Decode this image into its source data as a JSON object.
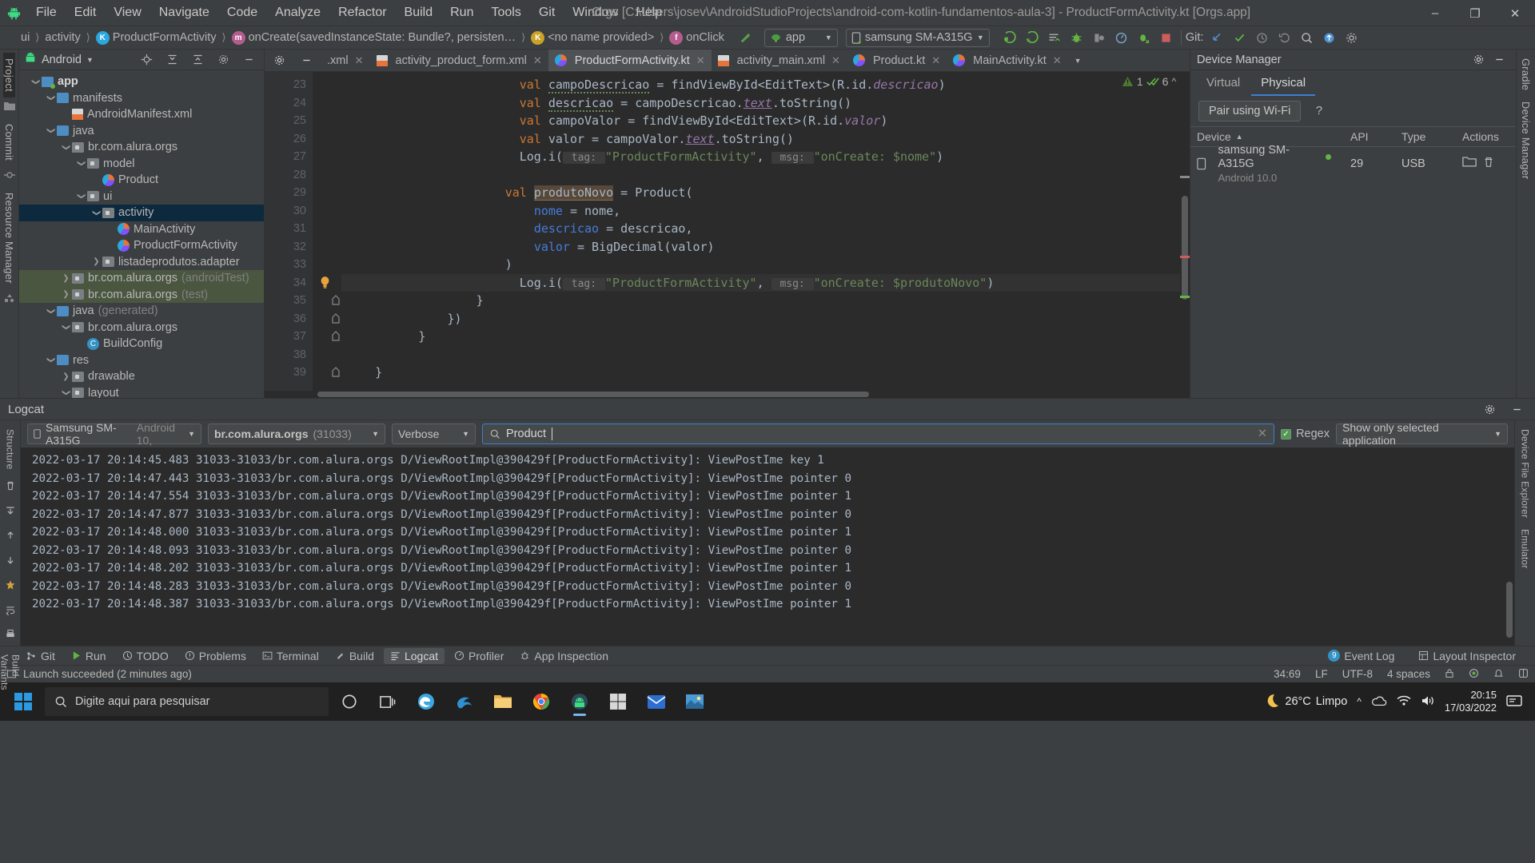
{
  "window": {
    "title": "Orgs [C:\\Users\\josev\\AndroidStudioProjects\\android-com-kotlin-fundamentos-aula-3] - ProductFormActivity.kt [Orgs.app]",
    "minimize": "–",
    "maximize": "❐",
    "close": "✕"
  },
  "menu": [
    "File",
    "Edit",
    "View",
    "Navigate",
    "Code",
    "Analyze",
    "Refactor",
    "Build",
    "Run",
    "Tools",
    "Git",
    "Window",
    "Help"
  ],
  "breadcrumbs": [
    {
      "label": "ui",
      "icon": ""
    },
    {
      "label": "activity",
      "icon": ""
    },
    {
      "label": "ProductFormActivity",
      "icon": "kotlin-class-icon"
    },
    {
      "label": "onCreate(savedInstanceState: Bundle?, persisten…",
      "icon": "method-icon"
    },
    {
      "label": "<no name provided>",
      "icon": "kotlin-object-icon"
    },
    {
      "label": "onClick",
      "icon": "function-icon"
    }
  ],
  "toolbar": {
    "module_selector": "app",
    "device_selector": "samsung SM-A315G",
    "git_label": "Git:",
    "icons": [
      "run-icon",
      "run-with-coverage-icon",
      "apply-changes-icon",
      "debug-icon",
      "profile-icon",
      "app-inspection-icon",
      "attach-debugger-icon",
      "stop-icon",
      "git-update-icon",
      "git-commit-icon",
      "git-history-icon",
      "search-icon",
      "upload-icon",
      "settings-icon"
    ]
  },
  "left_rail": [
    "Project",
    "Commit",
    "Resource Manager"
  ],
  "left_rail_bottom": [
    "Structure",
    "Favorites",
    "Build Variants"
  ],
  "right_rail": [
    "Gradle",
    "Device Manager",
    "Device File Explorer",
    "Emulator"
  ],
  "project_panel": {
    "title": "Android",
    "header_icons": [
      "locate-icon",
      "expand-all-icon",
      "collapse-all-icon",
      "settings-icon",
      "hide-icon"
    ],
    "tree": [
      {
        "depth": 0,
        "arrow": "down",
        "icon": "folder-module",
        "label": "app",
        "suffix": "",
        "bold": true,
        "state": "normal"
      },
      {
        "depth": 1,
        "arrow": "down",
        "icon": "folder-blue",
        "label": "manifests",
        "suffix": "",
        "bold": false,
        "state": "normal"
      },
      {
        "depth": 2,
        "arrow": "none",
        "icon": "xml-file",
        "label": "AndroidManifest.xml",
        "suffix": "",
        "bold": false,
        "state": "normal"
      },
      {
        "depth": 1,
        "arrow": "down",
        "icon": "folder-blue",
        "label": "java",
        "suffix": "",
        "bold": false,
        "state": "normal"
      },
      {
        "depth": 2,
        "arrow": "down",
        "icon": "folder-package",
        "label": "br.com.alura.orgs",
        "suffix": "",
        "bold": false,
        "state": "normal"
      },
      {
        "depth": 3,
        "arrow": "down",
        "icon": "folder-package",
        "label": "model",
        "suffix": "",
        "bold": false,
        "state": "normal"
      },
      {
        "depth": 4,
        "arrow": "none",
        "icon": "kotlin-file",
        "label": "Product",
        "suffix": "",
        "bold": false,
        "state": "normal"
      },
      {
        "depth": 3,
        "arrow": "down",
        "icon": "folder-package",
        "label": "ui",
        "suffix": "",
        "bold": false,
        "state": "normal"
      },
      {
        "depth": 4,
        "arrow": "down",
        "icon": "folder-package",
        "label": "activity",
        "suffix": "",
        "bold": false,
        "state": "selected"
      },
      {
        "depth": 5,
        "arrow": "none",
        "icon": "kotlin-file",
        "label": "MainActivity",
        "suffix": "",
        "bold": false,
        "state": "normal"
      },
      {
        "depth": 5,
        "arrow": "none",
        "icon": "kotlin-file",
        "label": "ProductFormActivity",
        "suffix": "",
        "bold": false,
        "state": "normal"
      },
      {
        "depth": 4,
        "arrow": "right",
        "icon": "folder-package",
        "label": "listadeprodutos.adapter",
        "suffix": "",
        "bold": false,
        "state": "normal"
      },
      {
        "depth": 2,
        "arrow": "right",
        "icon": "folder-package",
        "label": "br.com.alura.orgs",
        "suffix": "(androidTest)",
        "bold": false,
        "state": "testsrc"
      },
      {
        "depth": 2,
        "arrow": "right",
        "icon": "folder-package",
        "label": "br.com.alura.orgs",
        "suffix": "(test)",
        "bold": false,
        "state": "testsrc"
      },
      {
        "depth": 1,
        "arrow": "down",
        "icon": "folder-generated",
        "label": "java",
        "suffix": "(generated)",
        "bold": false,
        "state": "normal"
      },
      {
        "depth": 2,
        "arrow": "down",
        "icon": "folder-package",
        "label": "br.com.alura.orgs",
        "suffix": "",
        "bold": false,
        "state": "normal"
      },
      {
        "depth": 3,
        "arrow": "none",
        "icon": "class-file",
        "label": "BuildConfig",
        "suffix": "",
        "bold": false,
        "state": "normal"
      },
      {
        "depth": 1,
        "arrow": "down",
        "icon": "folder-res",
        "label": "res",
        "suffix": "",
        "bold": false,
        "state": "normal"
      },
      {
        "depth": 2,
        "arrow": "right",
        "icon": "folder-package",
        "label": "drawable",
        "suffix": "",
        "bold": false,
        "state": "normal"
      },
      {
        "depth": 2,
        "arrow": "down",
        "icon": "folder-package",
        "label": "layout",
        "suffix": "",
        "bold": false,
        "state": "normal"
      }
    ]
  },
  "editor": {
    "tabs": [
      {
        "label": ".xml",
        "icon": "xml-file",
        "active": false
      },
      {
        "label": "activity_product_form.xml",
        "icon": "xml-file",
        "active": false
      },
      {
        "label": "ProductFormActivity.kt",
        "icon": "kotlin-file",
        "active": true
      },
      {
        "label": "activity_main.xml",
        "icon": "xml-file",
        "active": false
      },
      {
        "label": "Product.kt",
        "icon": "kotlin-file",
        "active": false
      },
      {
        "label": "MainActivity.kt",
        "icon": "kotlin-file",
        "active": false
      }
    ],
    "inspection": {
      "warnings": "1",
      "checks": "6"
    },
    "first_line_number": 23,
    "lines": [
      {
        "n": 23,
        "indent": 12,
        "segments": [
          {
            "t": "val ",
            "c": "kw"
          },
          {
            "t": "campoDescricao",
            "c": "warnsq"
          },
          {
            "t": " = findViewById<EditText>(R.id.",
            "c": "plain"
          },
          {
            "t": "descricao",
            "c": "pv"
          },
          {
            "t": ")",
            "c": "plain"
          }
        ]
      },
      {
        "n": 24,
        "indent": 12,
        "segments": [
          {
            "t": "val ",
            "c": "kw"
          },
          {
            "t": "descricao",
            "c": "warnsq"
          },
          {
            "t": " = campoDescricao.",
            "c": "plain"
          },
          {
            "t": "text",
            "c": "pv-u"
          },
          {
            "t": ".toString()",
            "c": "plain"
          }
        ]
      },
      {
        "n": 25,
        "indent": 12,
        "segments": [
          {
            "t": "val ",
            "c": "kw"
          },
          {
            "t": "campoValor",
            "c": "plain"
          },
          {
            "t": " = findViewById<EditText>(R.id.",
            "c": "plain"
          },
          {
            "t": "valor",
            "c": "pv"
          },
          {
            "t": ")",
            "c": "plain"
          }
        ]
      },
      {
        "n": 26,
        "indent": 12,
        "segments": [
          {
            "t": "val ",
            "c": "kw"
          },
          {
            "t": "valor",
            "c": "plain"
          },
          {
            "t": " = campoValor.",
            "c": "plain"
          },
          {
            "t": "text",
            "c": "pv-u"
          },
          {
            "t": ".toString()",
            "c": "plain"
          }
        ]
      },
      {
        "n": 27,
        "indent": 12,
        "segments": [
          {
            "t": "Log.i(",
            "c": "plain"
          },
          {
            "t": " tag: ",
            "c": "param"
          },
          {
            "t": "\"ProductFormActivity\"",
            "c": "str"
          },
          {
            "t": ", ",
            "c": "plain"
          },
          {
            "t": " msg: ",
            "c": "param"
          },
          {
            "t": "\"onCreate: $nome\"",
            "c": "str"
          },
          {
            "t": ")",
            "c": "plain"
          }
        ]
      },
      {
        "n": 28,
        "indent": 0,
        "segments": []
      },
      {
        "n": 29,
        "indent": 11,
        "segments": [
          {
            "t": "val ",
            "c": "kw"
          },
          {
            "t": "produtoNovo",
            "c": "hl"
          },
          {
            "t": " = Product(",
            "c": "plain"
          }
        ]
      },
      {
        "n": 30,
        "indent": 13,
        "segments": [
          {
            "t": "nome",
            "c": "named"
          },
          {
            "t": " = nome,",
            "c": "plain"
          }
        ]
      },
      {
        "n": 31,
        "indent": 13,
        "segments": [
          {
            "t": "descricao",
            "c": "named"
          },
          {
            "t": " = descricao,",
            "c": "plain"
          }
        ]
      },
      {
        "n": 32,
        "indent": 13,
        "segments": [
          {
            "t": "valor",
            "c": "named"
          },
          {
            "t": " = BigDecimal(valor)",
            "c": "plain"
          }
        ]
      },
      {
        "n": 33,
        "indent": 11,
        "segments": [
          {
            "t": ")",
            "c": "plain"
          }
        ]
      },
      {
        "n": 34,
        "indent": 12,
        "segments": [
          {
            "t": "Log.i(",
            "c": "plain"
          },
          {
            "t": " tag: ",
            "c": "param"
          },
          {
            "t": "\"ProductFormActivity\"",
            "c": "str"
          },
          {
            "t": ", ",
            "c": "plain"
          },
          {
            "t": " msg: ",
            "c": "param"
          },
          {
            "t": "\"onCreate: $produtoNovo\"",
            "c": "str"
          },
          {
            "t": ")",
            "c": "plain"
          }
        ]
      },
      {
        "n": 35,
        "indent": 9,
        "segments": [
          {
            "t": "}",
            "c": "plain"
          }
        ]
      },
      {
        "n": 36,
        "indent": 7,
        "segments": [
          {
            "t": "})",
            "c": "plain"
          }
        ]
      },
      {
        "n": 37,
        "indent": 5,
        "segments": [
          {
            "t": "}",
            "c": "plain"
          }
        ]
      },
      {
        "n": 38,
        "indent": 0,
        "segments": []
      },
      {
        "n": 39,
        "indent": 2,
        "segments": [
          {
            "t": "}",
            "c": "plain"
          }
        ]
      }
    ],
    "current_line": 34,
    "bulb_line": 34
  },
  "device_manager": {
    "title": "Device Manager",
    "tabs": [
      "Virtual",
      "Physical"
    ],
    "active_tab": "Physical",
    "pair_button": "Pair using Wi-Fi",
    "help_icon": "?",
    "columns": [
      "Device",
      "API",
      "Type",
      "Actions"
    ],
    "rows": [
      {
        "device": "samsung SM-A315G",
        "os": "Android 10.0",
        "api": "29",
        "type": "USB",
        "online": true
      }
    ]
  },
  "logcat": {
    "title": "Logcat",
    "device_selector": "Samsung SM-A315G",
    "device_selector_suffix": "Android 10,",
    "process_selector": "br.com.alura.orgs",
    "process_pid": "(31033)",
    "level_selector": "Verbose",
    "search_value": "Product",
    "search_placeholder": "Search",
    "regex_label": "Regex",
    "scope_selector": "Show only selected application",
    "lines": [
      "2022-03-17 20:14:45.483 31033-31033/br.com.alura.orgs D/ViewRootImpl@390429f[ProductFormActivity]: ViewPostIme key 1",
      "2022-03-17 20:14:47.443 31033-31033/br.com.alura.orgs D/ViewRootImpl@390429f[ProductFormActivity]: ViewPostIme pointer 0",
      "2022-03-17 20:14:47.554 31033-31033/br.com.alura.orgs D/ViewRootImpl@390429f[ProductFormActivity]: ViewPostIme pointer 1",
      "2022-03-17 20:14:47.877 31033-31033/br.com.alura.orgs D/ViewRootImpl@390429f[ProductFormActivity]: ViewPostIme pointer 0",
      "2022-03-17 20:14:48.000 31033-31033/br.com.alura.orgs D/ViewRootImpl@390429f[ProductFormActivity]: ViewPostIme pointer 1",
      "2022-03-17 20:14:48.093 31033-31033/br.com.alura.orgs D/ViewRootImpl@390429f[ProductFormActivity]: ViewPostIme pointer 0",
      "2022-03-17 20:14:48.202 31033-31033/br.com.alura.orgs D/ViewRootImpl@390429f[ProductFormActivity]: ViewPostIme pointer 1",
      "2022-03-17 20:14:48.283 31033-31033/br.com.alura.orgs D/ViewRootImpl@390429f[ProductFormActivity]: ViewPostIme pointer 0",
      "2022-03-17 20:14:48.387 31033-31033/br.com.alura.orgs D/ViewRootImpl@390429f[ProductFormActivity]: ViewPostIme pointer 1"
    ]
  },
  "tool_windows": [
    {
      "label": "Git",
      "icon": "git-icon",
      "active": false
    },
    {
      "label": "Run",
      "icon": "run-icon",
      "active": false
    },
    {
      "label": "TODO",
      "icon": "todo-icon",
      "active": false
    },
    {
      "label": "Problems",
      "icon": "problems-icon",
      "active": false
    },
    {
      "label": "Terminal",
      "icon": "terminal-icon",
      "active": false
    },
    {
      "label": "Build",
      "icon": "build-icon",
      "active": false
    },
    {
      "label": "Logcat",
      "icon": "logcat-icon",
      "active": true
    },
    {
      "label": "Profiler",
      "icon": "profiler-icon",
      "active": false
    },
    {
      "label": "App Inspection",
      "icon": "app-inspection-icon",
      "active": false
    }
  ],
  "tool_windows_right": [
    {
      "label": "Event Log",
      "icon": "event-log-icon",
      "badge": "9"
    },
    {
      "label": "Layout Inspector",
      "icon": "layout-inspector-icon",
      "badge": ""
    }
  ],
  "status_bar": {
    "message": "Launch succeeded (2 minutes ago)",
    "caret": "34:69",
    "line_sep": "LF",
    "encoding": "UTF-8",
    "indent": "4 spaces",
    "icons": [
      "lock-icon",
      "inspections-icon",
      "notifications-icon",
      "ide-mode-icon"
    ]
  },
  "taskbar": {
    "search_placeholder": "Digite aqui para pesquisar",
    "icons": [
      "start-icon",
      "search-icon",
      "cortana-icon",
      "task-view-icon",
      "edge-icon",
      "app-icon",
      "explorer-icon",
      "chrome-icon",
      "android-studio-icon",
      "store-icon",
      "mail-icon",
      "photos-icon"
    ],
    "weather_temp": "26°C",
    "weather_desc": "Limpo",
    "time": "20:15",
    "date": "17/03/2022",
    "tray": [
      "chevron-up-icon",
      "onedrive-icon",
      "network-icon",
      "volume-icon",
      "notifications-icon"
    ]
  },
  "colors": {
    "accent": "#3d7fd0",
    "bg": "#3c3f41",
    "editor_bg": "#2b2b2b",
    "selection": "#0d293e",
    "test_source": "#4b5640",
    "green": "#62b543",
    "orange": "#cc7832",
    "string": "#6a8759"
  }
}
